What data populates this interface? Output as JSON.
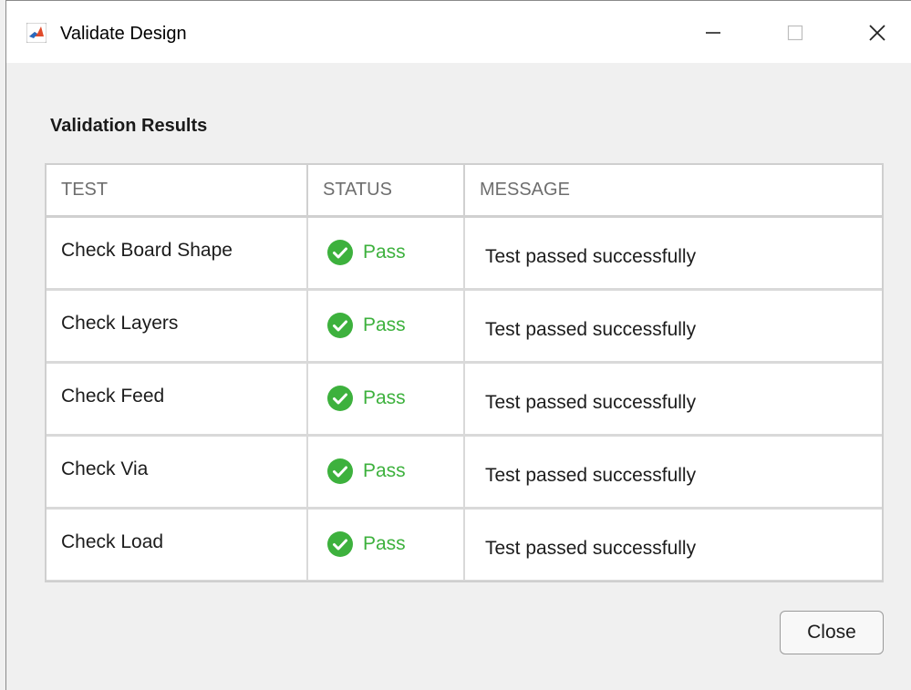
{
  "window": {
    "title": "Validate Design",
    "controls": {
      "minimize": "—",
      "maximize": "□",
      "close": "✕"
    }
  },
  "section_title": "Validation Results",
  "table": {
    "headers": [
      "TEST",
      "STATUS",
      "MESSAGE"
    ],
    "rows": [
      {
        "test": "Check Board Shape",
        "status": "Pass",
        "message": "Test passed successfully"
      },
      {
        "test": "Check Layers",
        "status": "Pass",
        "message": "Test passed successfully"
      },
      {
        "test": "Check Feed",
        "status": "Pass",
        "message": "Test passed successfully"
      },
      {
        "test": "Check Via",
        "status": "Pass",
        "message": "Test passed successfully"
      },
      {
        "test": "Check Load",
        "status": "Pass",
        "message": "Test passed successfully"
      }
    ]
  },
  "footer": {
    "close_label": "Close"
  },
  "colors": {
    "pass": "#3db13d",
    "accent": "#e04b2b"
  },
  "icons": {
    "app": "matlab-logo-icon",
    "status": "check-circle-icon"
  }
}
